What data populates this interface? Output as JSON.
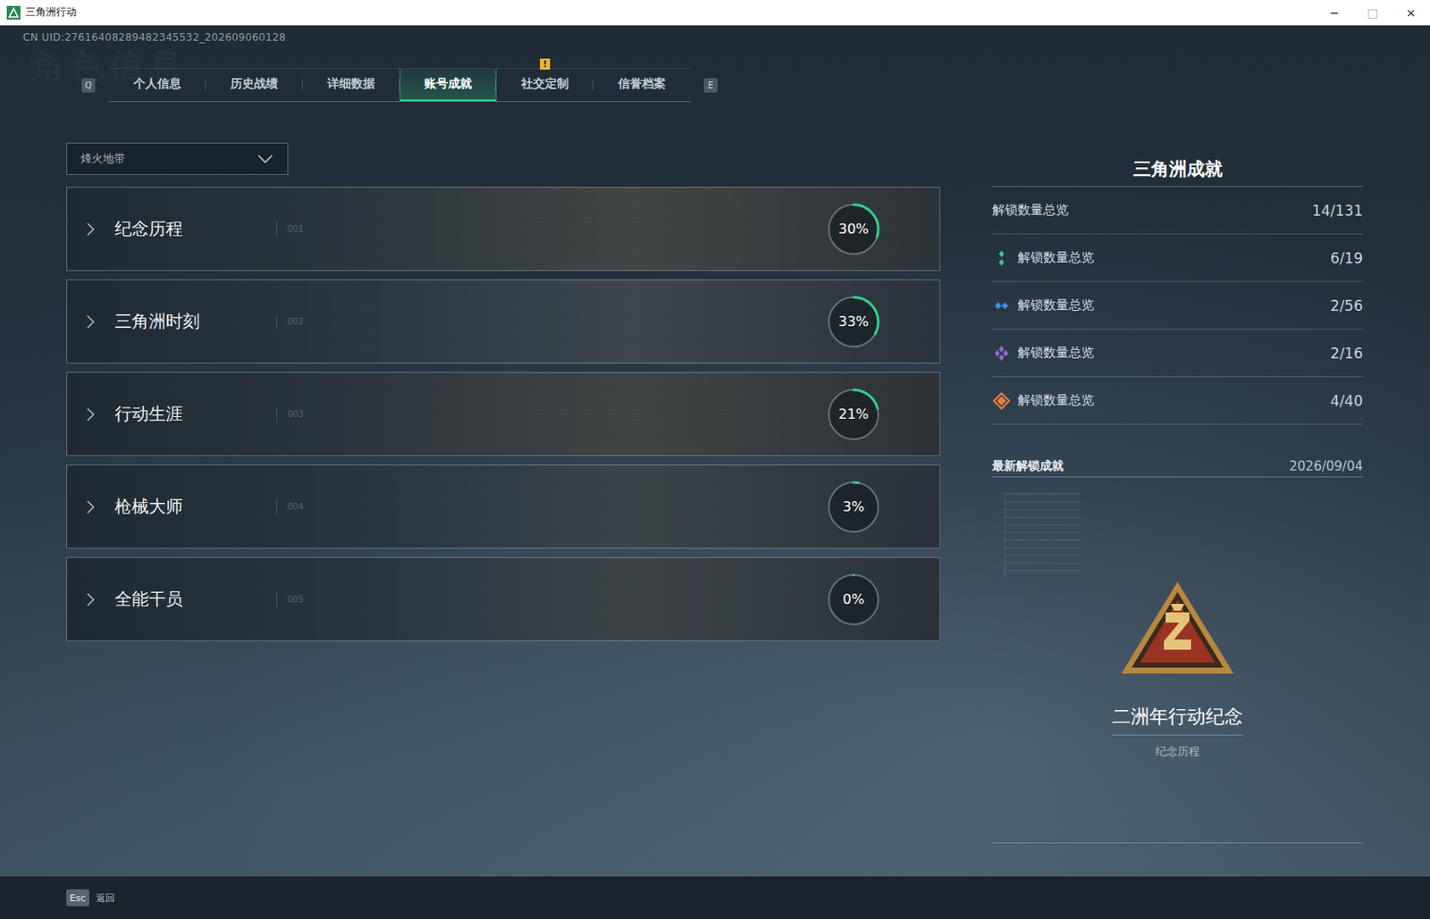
{
  "window": {
    "title": "三角洲行动",
    "controls": [
      "−",
      "□",
      "×"
    ]
  },
  "uid": "CN UID:27616408289482345532_202609060128",
  "watermark": "角色信息",
  "tab_keys": {
    "prev": "Q",
    "next": "E"
  },
  "tabs": [
    {
      "label": "个人信息",
      "selected": false,
      "badge": null
    },
    {
      "label": "历史战绩",
      "selected": false,
      "badge": null
    },
    {
      "label": "详细数据",
      "selected": false,
      "badge": null
    },
    {
      "label": "账号成就",
      "selected": true,
      "badge": null
    },
    {
      "label": "社交定制",
      "selected": false,
      "badge": "!"
    },
    {
      "label": "信誉档案",
      "selected": false,
      "badge": null
    }
  ],
  "mode_select": {
    "value": "烽火地带"
  },
  "categories": [
    {
      "name": "纪念历程",
      "index": "001",
      "percent": "30%",
      "level": 0.3
    },
    {
      "name": "三角洲时刻",
      "index": "002",
      "percent": "33%",
      "level": 0.33
    },
    {
      "name": "行动生涯",
      "index": "003",
      "percent": "21%",
      "level": 0.21
    },
    {
      "name": "枪械大师",
      "index": "004",
      "percent": "3%",
      "level": 0.03
    },
    {
      "name": "全能干员",
      "index": "005",
      "percent": "0%",
      "level": 0
    }
  ],
  "achievements": {
    "title": "三角洲成就",
    "total": {
      "label": "解锁数量总览",
      "value": "14/131"
    },
    "tiers": [
      {
        "label": "解锁数量总览",
        "value": "6/19",
        "color": "#2fcf8c"
      },
      {
        "label": "解锁数量总览",
        "value": "2/56",
        "color": "#3d8fe6"
      },
      {
        "label": "解锁数量总览",
        "value": "2/16",
        "color": "#9a68d6"
      },
      {
        "label": "解锁数量总览",
        "value": "4/40",
        "color": "#e8823a"
      }
    ],
    "latest": {
      "label": "最新解锁成就",
      "date": "2026/09/04",
      "name": "二洲年行动纪念",
      "category": "纪念历程"
    }
  },
  "footer": {
    "key": "Esc",
    "label": "返回"
  }
}
